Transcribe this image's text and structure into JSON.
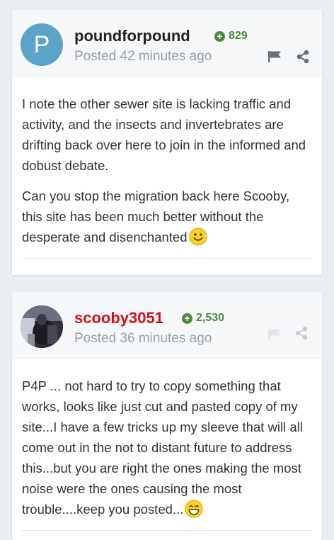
{
  "posts": [
    {
      "avatar_letter": "P",
      "author": "poundforpound",
      "reputation": "829",
      "posted": "Posted 42 minutes ago",
      "paragraphs": [
        "I note the other sewer site is lacking traffic and activity, and the insects and invertebrates are drifting back over here to join in the informed and dobust debate.",
        "Can you stop the migration back here Scooby, this site has been much better without the desperate and disenchanted"
      ]
    },
    {
      "author": "scooby3051",
      "reputation": "2,530",
      "posted": "Posted 36 minutes ago",
      "paragraphs": [
        "P4P ... not hard to try to copy something that works, looks like just cut and pasted copy of my site...I have a few tricks up my sleeve that will all come out in the not to distant future to address this...but you are right the ones making the most noise were the ones causing the most trouble....keep you posted..."
      ]
    }
  ],
  "colors": {
    "avatar_bg": "#5ba3c9",
    "reputation": "#4a8a3b",
    "author_highlight": "#d0121b"
  }
}
